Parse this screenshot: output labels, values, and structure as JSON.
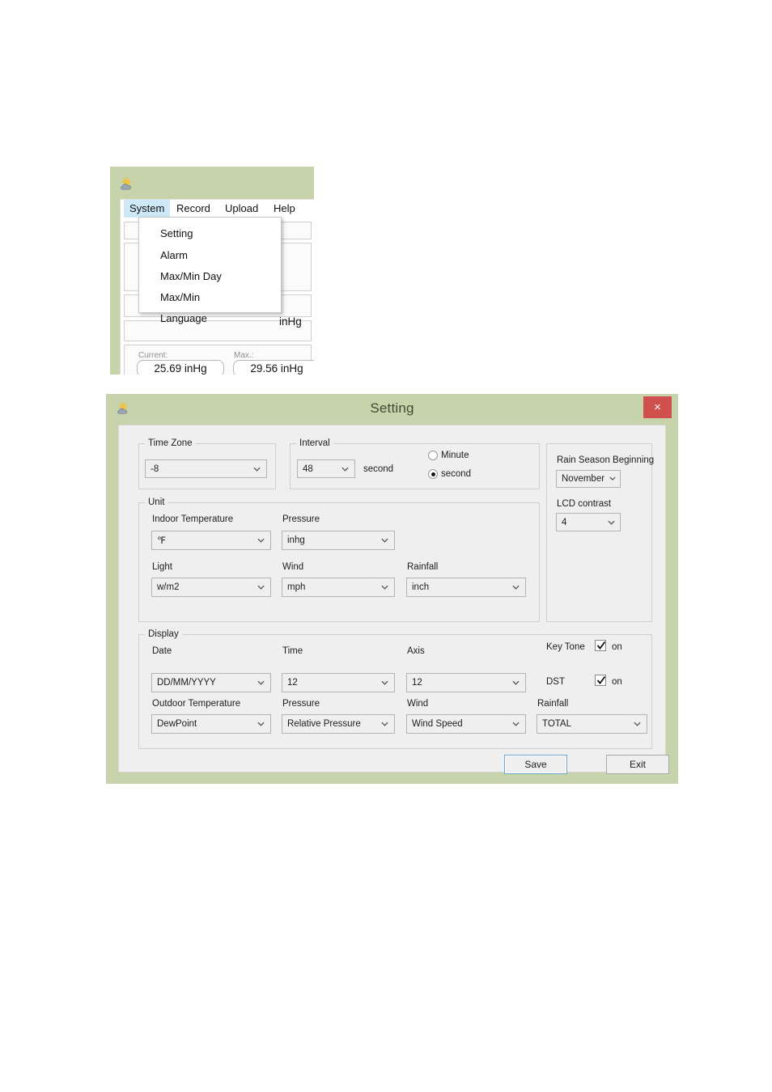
{
  "main_window": {
    "icon": "weather-sun-cloud-icon",
    "menubar": [
      {
        "label": "System",
        "active": true
      },
      {
        "label": "Record",
        "active": false
      },
      {
        "label": "Upload",
        "active": false
      },
      {
        "label": "Help",
        "active": false
      }
    ],
    "dropdown": {
      "owner": "System",
      "items": [
        {
          "label": "Setting"
        },
        {
          "label": "Alarm"
        },
        {
          "label": "Max/Min Day"
        },
        {
          "label": "Max/Min"
        },
        {
          "label": "Language"
        }
      ]
    },
    "background_readings": {
      "unit_text": "inHg",
      "current_label": "Current:",
      "max_label": "Max.:",
      "current_value": "25.69 inHg",
      "max_value": "29.56 inHg"
    }
  },
  "setting_dialog": {
    "icon": "weather-sun-cloud-icon",
    "title": "Setting",
    "close_label": "×",
    "close_color": "#d0504e",
    "frame_color": "#c7d3ab",
    "body_color": "#efefef",
    "time_zone": {
      "legend": "Time Zone",
      "value": "-8"
    },
    "interval": {
      "legend": "Interval",
      "value": "48",
      "suffix": "second",
      "radios": [
        {
          "label": "Minute",
          "checked": false
        },
        {
          "label": "second",
          "checked": true
        }
      ]
    },
    "unit": {
      "legend": "Unit",
      "fields": [
        {
          "label": "Indoor Temperature",
          "value": "℉"
        },
        {
          "label": "Pressure",
          "value": "inhg"
        },
        {
          "label": "Light",
          "value": "w/m2"
        },
        {
          "label": "Wind",
          "value": "mph"
        },
        {
          "label": "Rainfall",
          "value": "inch"
        }
      ]
    },
    "right_panel": {
      "rain_season_label": "Rain Season Beginning",
      "rain_season_value": "November",
      "lcd_contrast_label": "LCD contrast",
      "lcd_contrast_value": "4"
    },
    "display": {
      "legend": "Display",
      "fields": [
        {
          "label": "Date",
          "value": "DD/MM/YYYY"
        },
        {
          "label": "Time",
          "value": "12"
        },
        {
          "label": "Axis",
          "value": "12"
        },
        {
          "label": "Outdoor Temperature",
          "value": "DewPoint"
        },
        {
          "label": "Pressure",
          "value": "Relative Pressure"
        },
        {
          "label": "Wind",
          "value": "Wind Speed"
        },
        {
          "label": "Rainfall",
          "value": "TOTAL"
        }
      ],
      "toggles": [
        {
          "label": "Key Tone",
          "checked": true,
          "state_text": "on"
        },
        {
          "label": "DST",
          "checked": true,
          "state_text": "on"
        }
      ]
    },
    "buttons": {
      "save": "Save",
      "exit": "Exit"
    }
  }
}
